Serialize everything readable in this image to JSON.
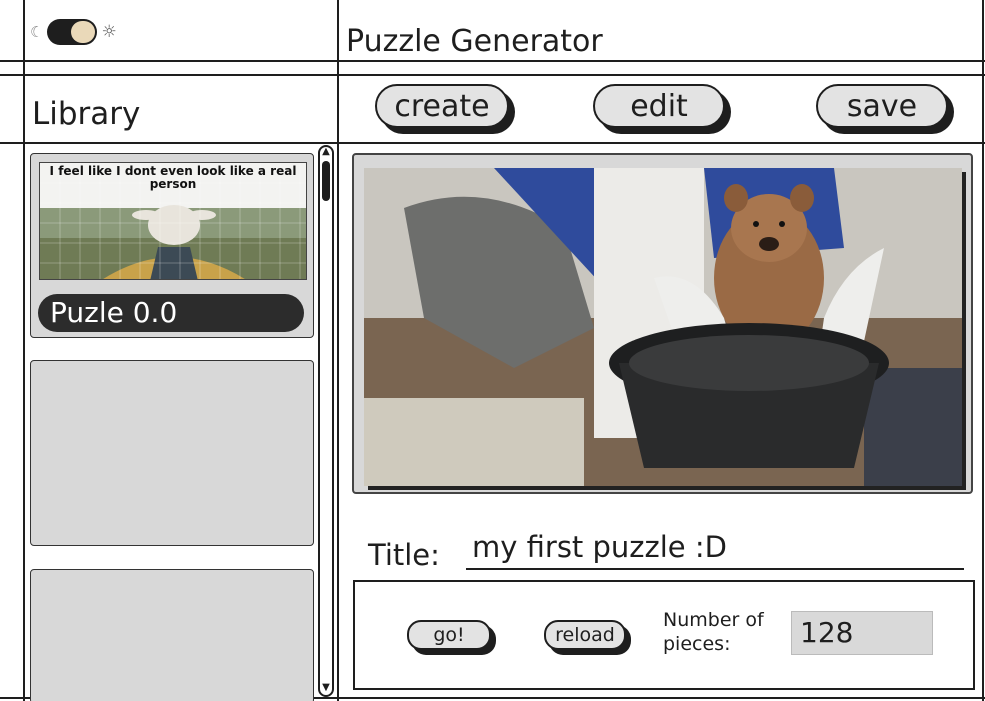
{
  "theme_toggle": {
    "moon_icon": "moon-icon",
    "sun_icon": "sun-icon",
    "state": "light"
  },
  "app": {
    "title": "Puzzle Generator"
  },
  "library": {
    "heading": "Library",
    "items": [
      {
        "caption": "I feel like I dont even look like a real person",
        "label": "Puzle 0.0"
      },
      {
        "label": ""
      },
      {
        "label": ""
      }
    ]
  },
  "toolbar": {
    "create_label": "create",
    "edit_label": "edit",
    "save_label": "save"
  },
  "editor": {
    "title_label": "Title:",
    "title_value": "my first puzzle :D"
  },
  "controls": {
    "go_label": "go!",
    "reload_label": "reload",
    "pieces_label_line1": "Number of",
    "pieces_label_line2": "pieces:",
    "pieces_value": "128"
  }
}
